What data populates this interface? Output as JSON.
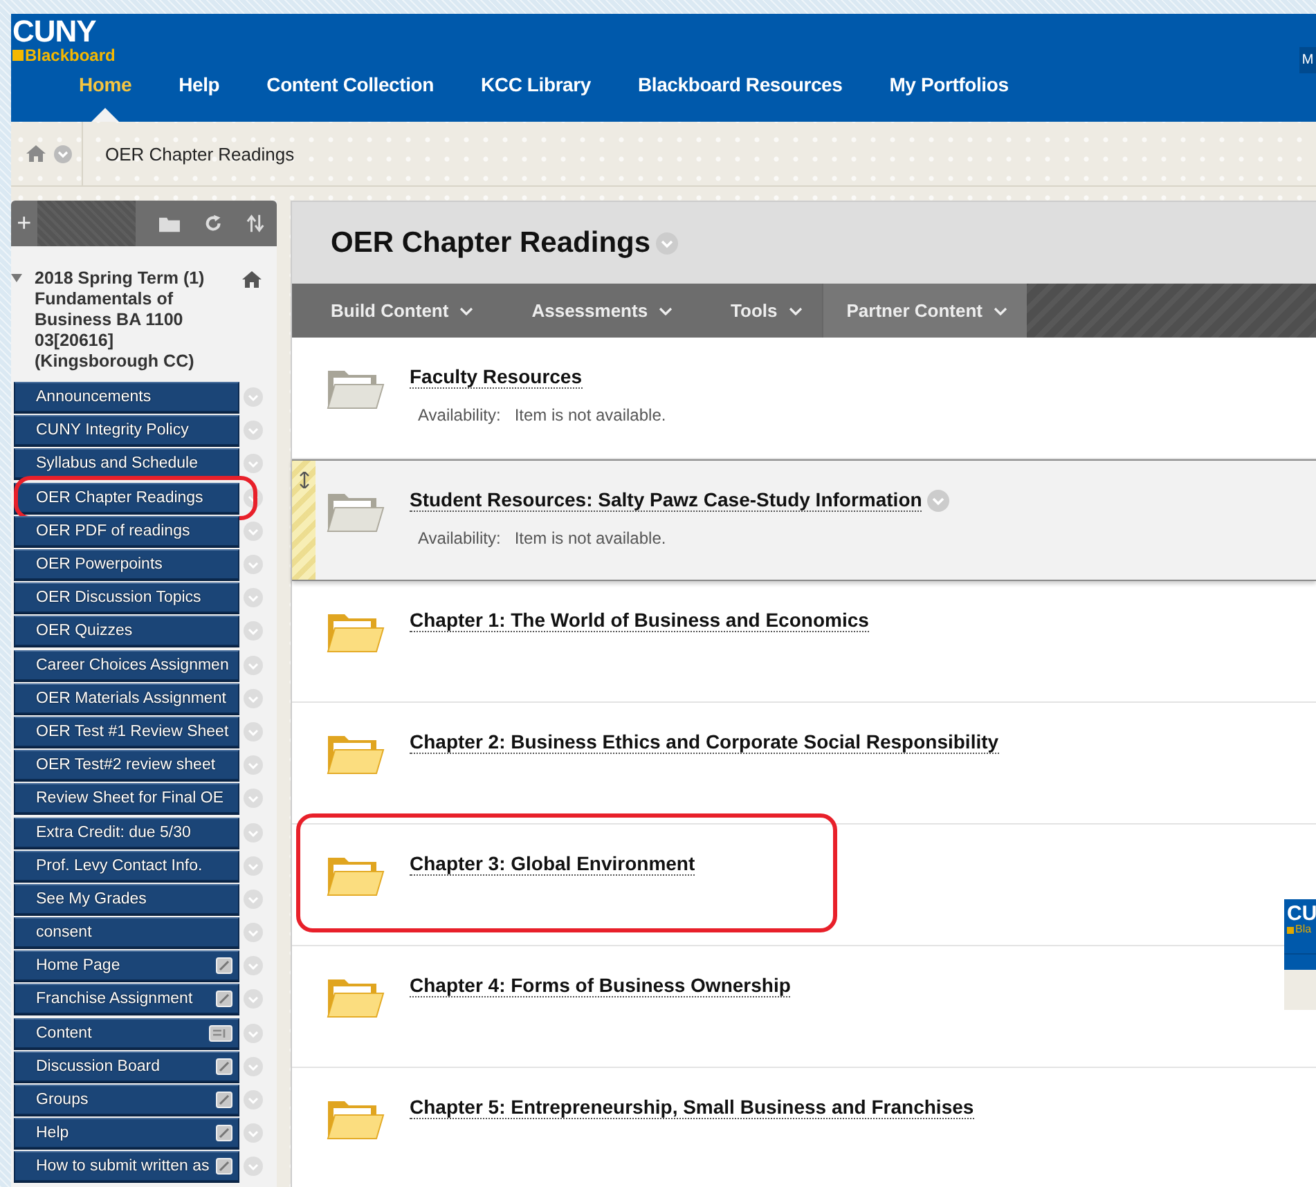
{
  "header": {
    "logo_top": "CUNY",
    "logo_bottom": "Blackboard",
    "edge_link": "M",
    "tabs": [
      {
        "label": "Home",
        "selected": true
      },
      {
        "label": "Help",
        "selected": false
      },
      {
        "label": "Content Collection",
        "selected": false
      },
      {
        "label": "KCC Library",
        "selected": false
      },
      {
        "label": "Blackboard Resources",
        "selected": false
      },
      {
        "label": "My Portfolios",
        "selected": false
      }
    ]
  },
  "breadcrumb": {
    "current": "OER Chapter Readings"
  },
  "sidebar": {
    "add": "+",
    "course_title": "2018 Spring Term (1) Fundamentals of Business BA 1100 03[20616] (Kingsborough CC)",
    "items": [
      {
        "label": "Announcements",
        "kind": "link",
        "circled": false
      },
      {
        "label": "CUNY Integrity Policy",
        "kind": "link",
        "circled": false
      },
      {
        "label": "Syllabus and Schedule",
        "kind": "link",
        "circled": false
      },
      {
        "label": "OER Chapter Readings",
        "kind": "link",
        "circled": true
      },
      {
        "label": "OER PDF of readings",
        "kind": "link",
        "circled": false
      },
      {
        "label": "OER Powerpoints",
        "kind": "link",
        "circled": false
      },
      {
        "label": "OER Discussion Topics",
        "kind": "link",
        "circled": false
      },
      {
        "label": "OER Quizzes",
        "kind": "link",
        "circled": false
      },
      {
        "label": "Career Choices Assignmen",
        "kind": "link",
        "circled": false
      },
      {
        "label": "OER Materials Assignment",
        "kind": "link",
        "circled": false
      },
      {
        "label": "OER Test #1 Review Sheet",
        "kind": "link",
        "circled": false
      },
      {
        "label": "OER Test#2 review sheet",
        "kind": "link",
        "circled": false
      },
      {
        "label": "Review Sheet for Final OE",
        "kind": "link",
        "circled": false
      },
      {
        "label": "Extra Credit: due 5/30",
        "kind": "link",
        "circled": false
      },
      {
        "label": "Prof. Levy Contact Info.",
        "kind": "link",
        "circled": false
      },
      {
        "label": "See My Grades",
        "kind": "link",
        "circled": false
      },
      {
        "label": "consent",
        "kind": "link",
        "circled": false
      },
      {
        "label": "Home Page",
        "kind": "tool",
        "circled": false
      },
      {
        "label": "Franchise Assignment",
        "kind": "tool",
        "circled": false
      },
      {
        "label": "Content",
        "kind": "module",
        "circled": false
      },
      {
        "label": "Discussion Board",
        "kind": "tool",
        "circled": false
      },
      {
        "label": "Groups",
        "kind": "tool",
        "circled": false
      },
      {
        "label": "Help",
        "kind": "tool",
        "circled": false
      },
      {
        "label": "How to submit written as",
        "kind": "tool",
        "circled": false
      }
    ]
  },
  "page": {
    "title": "OER Chapter Readings",
    "actions": [
      "Build Content",
      "Assessments",
      "Tools",
      "Partner Content"
    ],
    "items": [
      {
        "title": "Faculty Resources",
        "available": false,
        "hovered": false,
        "circled": false,
        "availability_label": "Availability:",
        "availability": "Item is not available."
      },
      {
        "title": "Student Resources: Salty Pawz Case-Study Information",
        "available": false,
        "hovered": true,
        "circled": false,
        "availability_label": "Availability:",
        "availability": "Item is not available."
      },
      {
        "title": "Chapter 1: The World of Business and Economics",
        "available": true,
        "hovered": false,
        "circled": false
      },
      {
        "title": "Chapter 2: Business Ethics and Corporate Social Responsibility",
        "available": true,
        "hovered": false,
        "circled": false
      },
      {
        "title": "Chapter 3: Global Environment",
        "available": true,
        "hovered": false,
        "circled": true
      },
      {
        "title": "Chapter 4: Forms of Business Ownership",
        "available": true,
        "hovered": false,
        "circled": false
      },
      {
        "title": "Chapter 5: Entrepreneurship, Small Business and Franchises",
        "available": true,
        "hovered": false,
        "circled": false
      }
    ]
  },
  "inset_window": {
    "logo_top": "CU",
    "logo_bottom": "Bla"
  }
}
